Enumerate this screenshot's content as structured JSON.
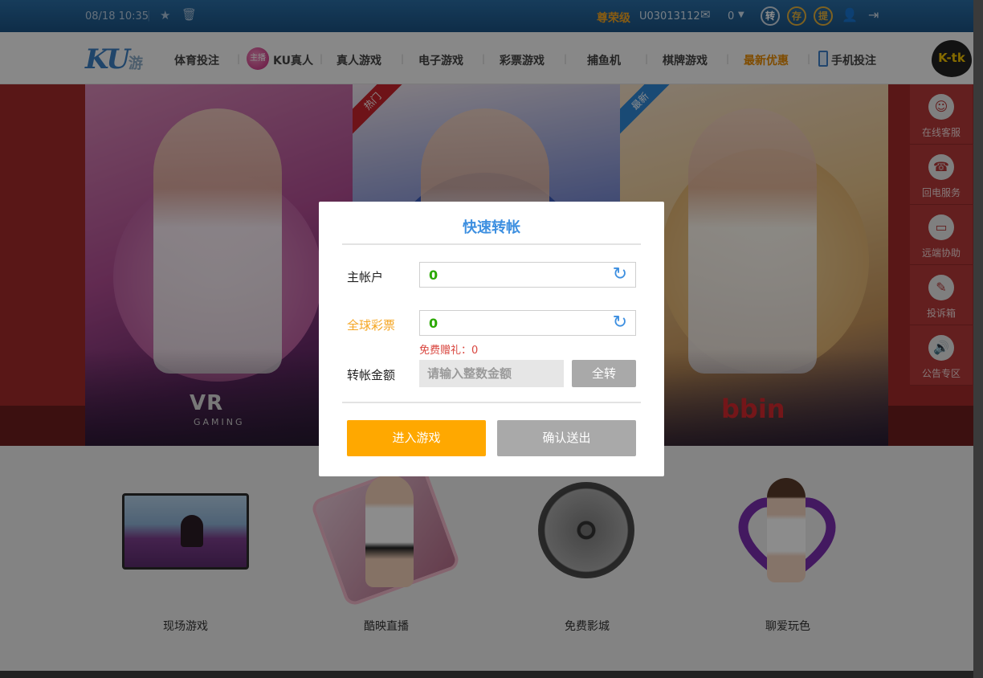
{
  "topbar": {
    "datetime": "08/18 10:35",
    "separator": "|",
    "vip_level": "尊荣级",
    "username": "U03013112",
    "balance": "0",
    "transfer_btn": "转",
    "deposit_btn": "存",
    "withdraw_btn": "提",
    "icons": [
      "star-icon",
      "trash-icon",
      "mail-icon",
      "caret-down-icon",
      "user-icon",
      "logout-icon"
    ]
  },
  "nav": {
    "logo_text": "KU",
    "logo_suffix": "游",
    "items": [
      "体育投注",
      "KU真人",
      "真人游戏",
      "电子游戏",
      "彩票游戏",
      "捕鱼机",
      "棋牌游戏",
      "最新优惠",
      "手机投注"
    ],
    "ku_badge": "主播",
    "separator": "|",
    "ktk_text": "K-tk"
  },
  "hero": {
    "panels": [
      {
        "brand": "VR",
        "brand_sub": "GAMING",
        "ribbon": ""
      },
      {
        "brand": "",
        "brand_sub": "",
        "ribbon": "热门"
      },
      {
        "brand": "bbin",
        "brand_sub": "",
        "ribbon": "最新"
      }
    ]
  },
  "sidebar": {
    "items": [
      {
        "label": "在线客服",
        "icon": "headset-icon"
      },
      {
        "label": "回电服务",
        "icon": "phone-icon"
      },
      {
        "label": "远端协助",
        "icon": "monitor-icon"
      },
      {
        "label": "投诉箱",
        "icon": "pencil-icon"
      },
      {
        "label": "公告专区",
        "icon": "speaker-icon"
      }
    ]
  },
  "tiles": [
    {
      "label": "现场游戏"
    },
    {
      "label": "酷映直播"
    },
    {
      "label": "免费影城"
    },
    {
      "label": "聊爱玩色"
    }
  ],
  "modal": {
    "title": "快速转帐",
    "main_account_label": "主帐户",
    "main_account_value": "0",
    "lottery_label": "全球彩票",
    "lottery_value": "0",
    "free_gift_text": "免费赠礼：0",
    "amount_label": "转帐金额",
    "amount_placeholder": "请输入整数金额",
    "amount_value": "",
    "all_transfer_btn": "全转",
    "enter_game_btn": "进入游戏",
    "confirm_btn": "确认送出"
  },
  "colors": {
    "accent_blue": "#3d8fe0",
    "orange": "#ffa800",
    "value_green": "#2aa800",
    "gift_red": "#d9453e",
    "sidebar_red": "#b53a3a"
  }
}
